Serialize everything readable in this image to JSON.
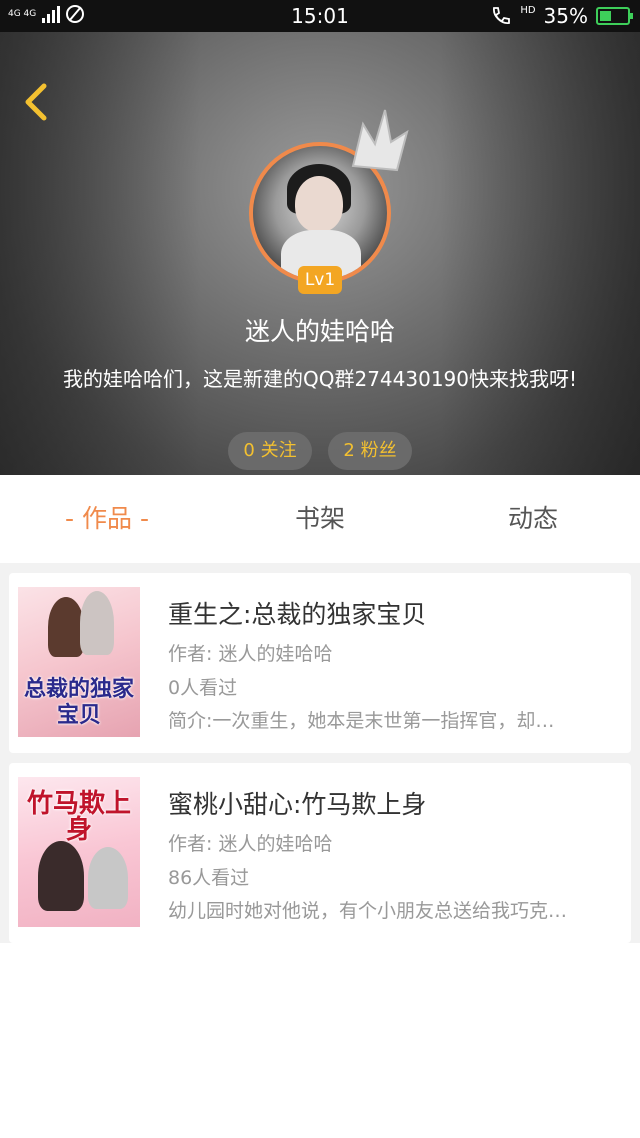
{
  "status_bar": {
    "network": "4G 4G",
    "time": "15:01",
    "hd": "HD",
    "battery_percent": "35%",
    "battery_level": 0.35
  },
  "profile": {
    "back_icon": "chevron-left-icon",
    "level": "Lv1",
    "name": "迷人的娃哈哈",
    "intro": "我的娃哈哈们，这是新建的QQ群274430190快来找我呀!",
    "following": "0 关注",
    "fans": "2 粉丝",
    "accent": "#f08a4b",
    "badge_color": "#f3a623",
    "pill_text_color": "#f3c030"
  },
  "tabs": [
    {
      "label": "- 作品 -",
      "active": true
    },
    {
      "label": "书架",
      "active": false
    },
    {
      "label": "动态",
      "active": false
    }
  ],
  "works": [
    {
      "title": "重生之:总裁的独家宝贝",
      "author": "作者: 迷人的娃哈哈",
      "views": "0人看过",
      "summary": "简介:一次重生，她本是末世第一指挥官，却…",
      "cover_text": "总裁的独家宝贝"
    },
    {
      "title": "蜜桃小甜心:竹马欺上身",
      "author": "作者: 迷人的娃哈哈",
      "views": "86人看过",
      "summary": "幼儿园时她对他说，有个小朋友总送给我巧克…",
      "cover_text": "竹马欺上身"
    }
  ]
}
